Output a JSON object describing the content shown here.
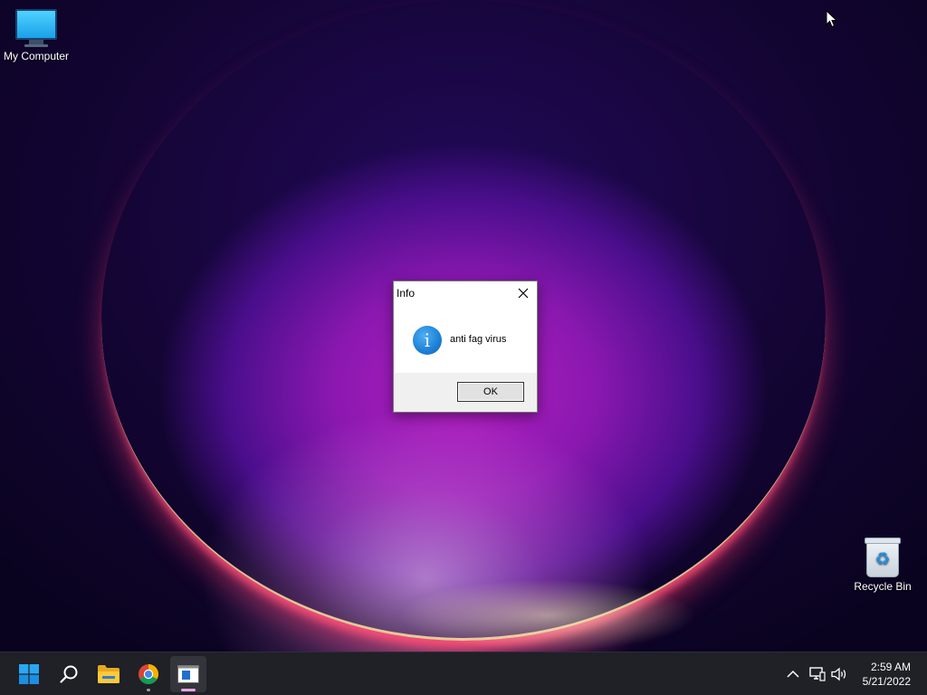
{
  "desktop": {
    "icons": [
      {
        "label": "My Computer",
        "icon": "monitor-icon"
      },
      {
        "label": "Recycle Bin",
        "icon": "recycle-bin-icon"
      }
    ]
  },
  "dialog": {
    "title": "Info",
    "icon": "info-icon",
    "icon_glyph": "i",
    "message": "anti fag virus",
    "ok_label": "OK",
    "close_icon": "close-icon"
  },
  "taskbar": {
    "items": [
      {
        "name": "start",
        "icon": "windows-logo-icon"
      },
      {
        "name": "search",
        "icon": "search-icon"
      },
      {
        "name": "file-explorer",
        "icon": "folder-icon"
      },
      {
        "name": "chrome",
        "icon": "chrome-icon",
        "running": true
      },
      {
        "name": "message-box-app",
        "icon": "window-app-icon",
        "active": true
      }
    ],
    "tray": {
      "icons": [
        "chevron-up-icon",
        "network-icon",
        "volume-icon"
      ],
      "time": "2:59 AM",
      "date": "5/21/2022"
    }
  },
  "colors": {
    "taskbar_bg": "#202027",
    "accent_blue": "#1c7fd6",
    "active_indicator": "#e9a4e6"
  }
}
